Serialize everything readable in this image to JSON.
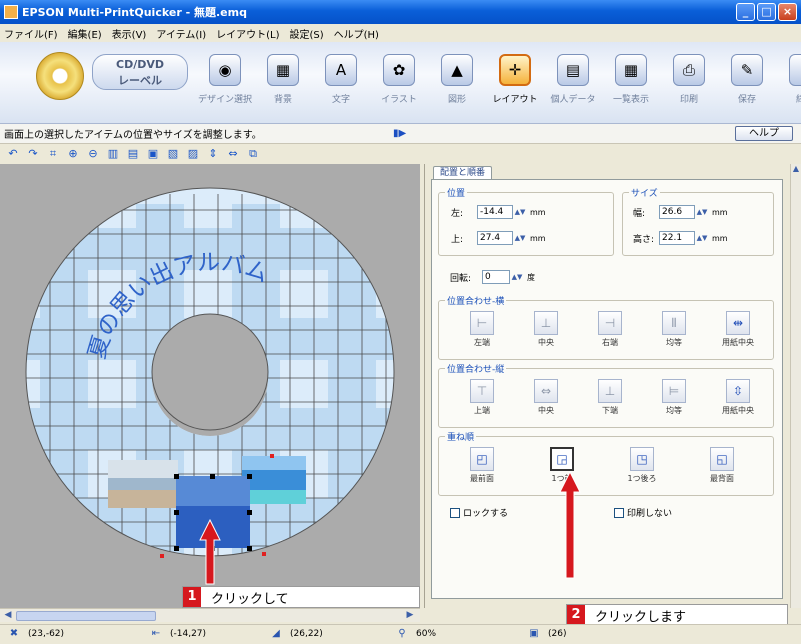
{
  "window": {
    "title": "EPSON Multi-PrintQuicker - 無題.emq",
    "buttons": [
      "_",
      "□",
      "×"
    ]
  },
  "menu": [
    "ファイル(F)",
    "編集(E)",
    "表示(V)",
    "アイテム(I)",
    "レイアウト(L)",
    "設定(S)",
    "ヘルプ(H)"
  ],
  "product": {
    "line1": "CD/DVD",
    "line2": "レーベル"
  },
  "tools": [
    {
      "label": "デザイン選択",
      "icon": "◉",
      "name": "design-select"
    },
    {
      "label": "背景",
      "icon": "▦",
      "name": "background"
    },
    {
      "label": "文字",
      "icon": "A",
      "name": "text"
    },
    {
      "label": "イラスト",
      "icon": "✿",
      "name": "illustration"
    },
    {
      "label": "図形",
      "icon": "▲",
      "name": "shape"
    },
    {
      "label": "レイアウト",
      "icon": "✛",
      "name": "layout"
    },
    {
      "label": "個人データ",
      "icon": "▤",
      "name": "personal-data"
    },
    {
      "label": "一覧表示",
      "icon": "▦",
      "name": "list-view"
    },
    {
      "label": "印刷",
      "icon": "⎙",
      "name": "print"
    },
    {
      "label": "保存",
      "icon": "✎",
      "name": "save"
    },
    {
      "label": "終了",
      "icon": "▮",
      "name": "exit"
    }
  ],
  "hint": "画面上の選択したアイテムの位置やサイズを調整します。",
  "help_label": "ヘルプ",
  "small_toolbar": [
    "↶",
    "↷",
    "⌗",
    "⊕",
    "⊖",
    "▥",
    "▤",
    "▣",
    "▧",
    "▨",
    "⇕",
    "⇔",
    "⧉"
  ],
  "cd_text": "夏の思い出アルバム",
  "panel": {
    "tab": "配置と順番",
    "position": {
      "title": "位置",
      "left_label": "左:",
      "left_value": "-14.4",
      "top_label": "上:",
      "top_value": "27.4",
      "unit": "mm"
    },
    "size": {
      "title": "サイズ",
      "width_label": "幅:",
      "width_value": "26.6",
      "height_label": "高さ:",
      "height_value": "22.1",
      "unit": "mm"
    },
    "rotation": {
      "label": "回転:",
      "value": "0",
      "unit": "度"
    },
    "align_h": {
      "title": "位置合わせ-横",
      "buttons": [
        "左端",
        "中央",
        "右端",
        "均等",
        "用紙中央"
      ]
    },
    "align_v": {
      "title": "位置合わせ-縦",
      "buttons": [
        "上端",
        "中央",
        "下端",
        "均等",
        "用紙中央"
      ]
    },
    "order": {
      "title": "重ね順",
      "buttons": [
        "最前面",
        "1つ前",
        "1つ後ろ",
        "最背面"
      ]
    },
    "lock_label": "ロックする",
    "noprint_label": "印刷しない"
  },
  "callouts": [
    {
      "number": "1",
      "text": "クリックして"
    },
    {
      "number": "2",
      "text": "クリックします"
    }
  ],
  "status": [
    {
      "icon": "✖",
      "value": "(23,-62)"
    },
    {
      "icon": "⇤",
      "value": "(-14,27)"
    },
    {
      "icon": "◢",
      "value": "(26,22)"
    },
    {
      "icon": "⚲",
      "value": "60%"
    },
    {
      "icon": "▣",
      "value": "(26)"
    }
  ]
}
